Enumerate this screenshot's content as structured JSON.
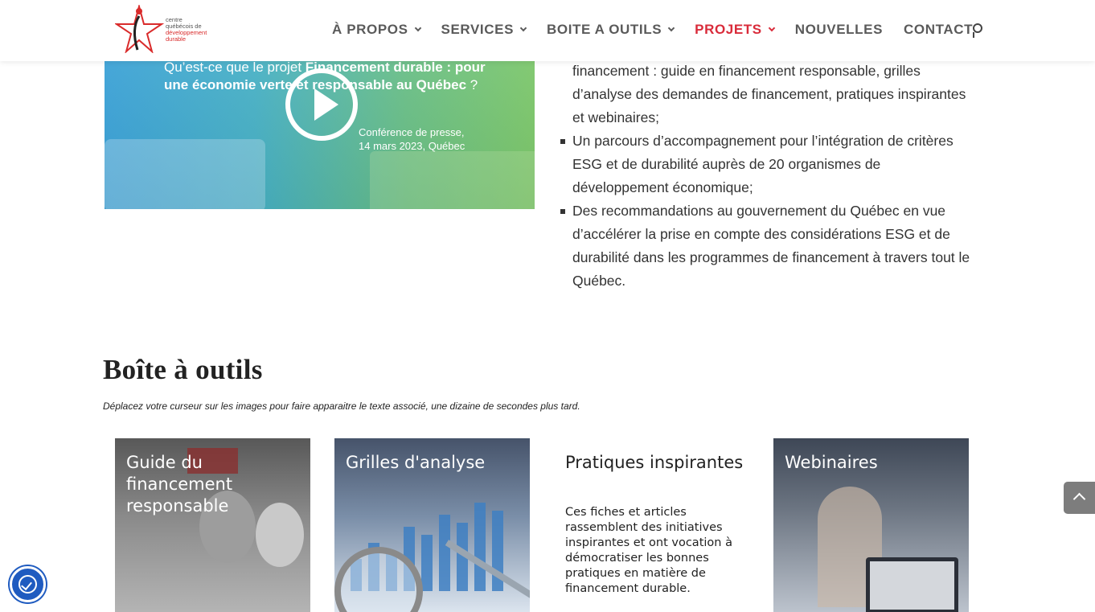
{
  "logo": {
    "line1": "centre",
    "line2": "québécois de",
    "line3": "développement",
    "line4": "durable"
  },
  "nav": {
    "items": [
      {
        "label": "À PROPOS"
      },
      {
        "label": "SERVICES"
      },
      {
        "label": "BOITE A OUTILS"
      },
      {
        "label": "PROJETS"
      },
      {
        "label": "NOUVELLES"
      },
      {
        "label": "CONTACT"
      }
    ],
    "active_color": "#d92b3a"
  },
  "video": {
    "title_prefix": "Qu’est-ce que le projet ",
    "title_bold": "Financement durable : pour une économie verte et responsable au Québec",
    "title_suffix": " ?",
    "subtitle_line1": "Conférence de presse,",
    "subtitle_line2": "14 mars 2023, Québec"
  },
  "list": {
    "intro_cont": "financement : guide en financement responsable, grilles d’analyse des demandes de financement, pratiques inspirantes et webinaires;",
    "items": [
      "Un parcours d’accompagnement pour l’intégration de critères ESG et de durabilité auprès de 20 organismes de développement économique;",
      "Des recommandations au gouvernement du Québec en vue d’accélérer la prise en compte des considérations ESG et de durabilité dans les programmes de financement à travers tout le Québec."
    ]
  },
  "section": {
    "title": "Boîte à outils",
    "note": "Déplacez votre curseur sur les images pour faire apparaitre le texte associé, une dizaine de secondes plus tard."
  },
  "cards": [
    {
      "title": "Guide du financement responsable"
    },
    {
      "title": "Grilles d'analyse"
    },
    {
      "title": "Pratiques inspirantes",
      "body": "Ces fiches et articles rassemblent des initiatives inspirantes et ont vocation à démocratiser les bonnes pratiques en matière de financement durable."
    },
    {
      "title": "Webinaires"
    }
  ]
}
